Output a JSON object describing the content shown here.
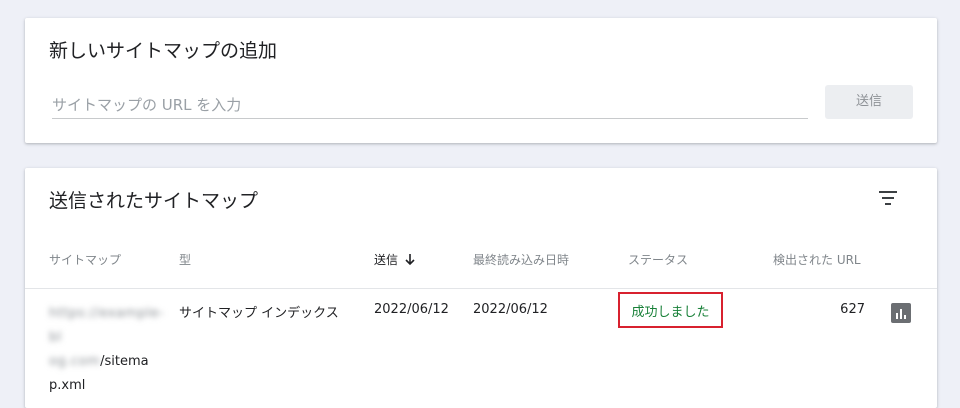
{
  "add_sitemap": {
    "title": "新しいサイトマップの追加",
    "input_placeholder": "サイトマップの URL を入力",
    "submit_label": "送信"
  },
  "submitted_sitemaps": {
    "title": "送信されたサイトマップ",
    "columns": {
      "sitemap": "サイトマップ",
      "type": "型",
      "submitted": "送信",
      "last_read": "最終読み込み日時",
      "status": "ステータス",
      "discovered_urls": "検出された URL"
    },
    "sort_icon": "arrow-down-icon",
    "filter_icon": "filter-icon",
    "rows": [
      {
        "sitemap_prefix_blurred": "https://example-bl",
        "sitemap_prefix_blurred_2": "og.com",
        "sitemap_suffix": "/sitema",
        "sitemap_suffix_2": "p.xml",
        "type": "サイトマップ インデックス",
        "submitted": "2022/06/12",
        "last_read": "2022/06/12",
        "status": "成功しました",
        "status_color": "#188038",
        "discovered_urls": "627",
        "action_icon": "bar-chart-icon"
      }
    ]
  },
  "colors": {
    "background": "#eef0f7",
    "highlight_border": "#d8212f"
  }
}
